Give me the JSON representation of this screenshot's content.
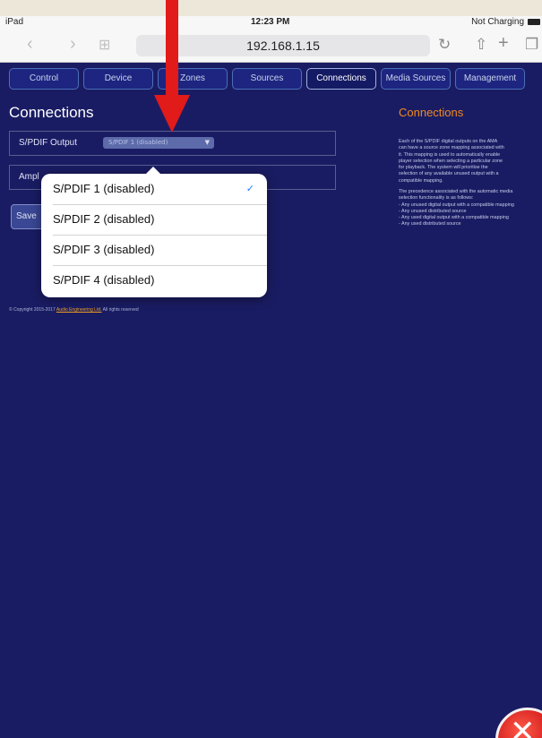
{
  "status_bar": {
    "device": "iPad",
    "time": "12:23 PM",
    "battery": "Not Charging"
  },
  "browser": {
    "url": "192.168.1.15"
  },
  "tabs": [
    {
      "label": "Control"
    },
    {
      "label": "Device"
    },
    {
      "label": "Zones"
    },
    {
      "label": "Sources"
    },
    {
      "label": "Connections",
      "active": true
    },
    {
      "label": "Media Sources"
    },
    {
      "label": "Management"
    }
  ],
  "main": {
    "title": "Connections",
    "spdif_label": "S/PDIF Output",
    "spdif_selected": "S/PDIF 1 (disabled)",
    "amp_label": "Ampl",
    "save_label": "Save",
    "copyright_prefix": "© Copyright 2015-2017",
    "copyright_link": "Audio Engineering Ltd.",
    "copyright_suffix": "All rights reserved"
  },
  "dropdown": {
    "options": [
      "S/PDIF 1 (disabled)",
      "S/PDIF 2 (disabled)",
      "S/PDIF 3 (disabled)",
      "S/PDIF 4 (disabled)"
    ],
    "checkmark": "✓"
  },
  "help": {
    "title": "Connections",
    "para1": "Each of the S/PDIF digital outputs on the AMA\ncan have a source zone mapping associated with\nit. This mapping is used to automatically enable\nplayer selection when selecting a particular zone\nfor playback. The system will prioritise the\nselection of any available unused output with a\ncompatible mapping.",
    "para2": "The precedence associated with the automatic media\nselection functionality is as follows:\n- Any unused digital output with a compatible mapping\n- Any unused distributed source\n- Any used digital output with a compatible mapping\n- Any used distributed source"
  },
  "colors": {
    "background": "#1a1c63",
    "accent": "#f28a1a",
    "arrow": "#e11a1a"
  }
}
